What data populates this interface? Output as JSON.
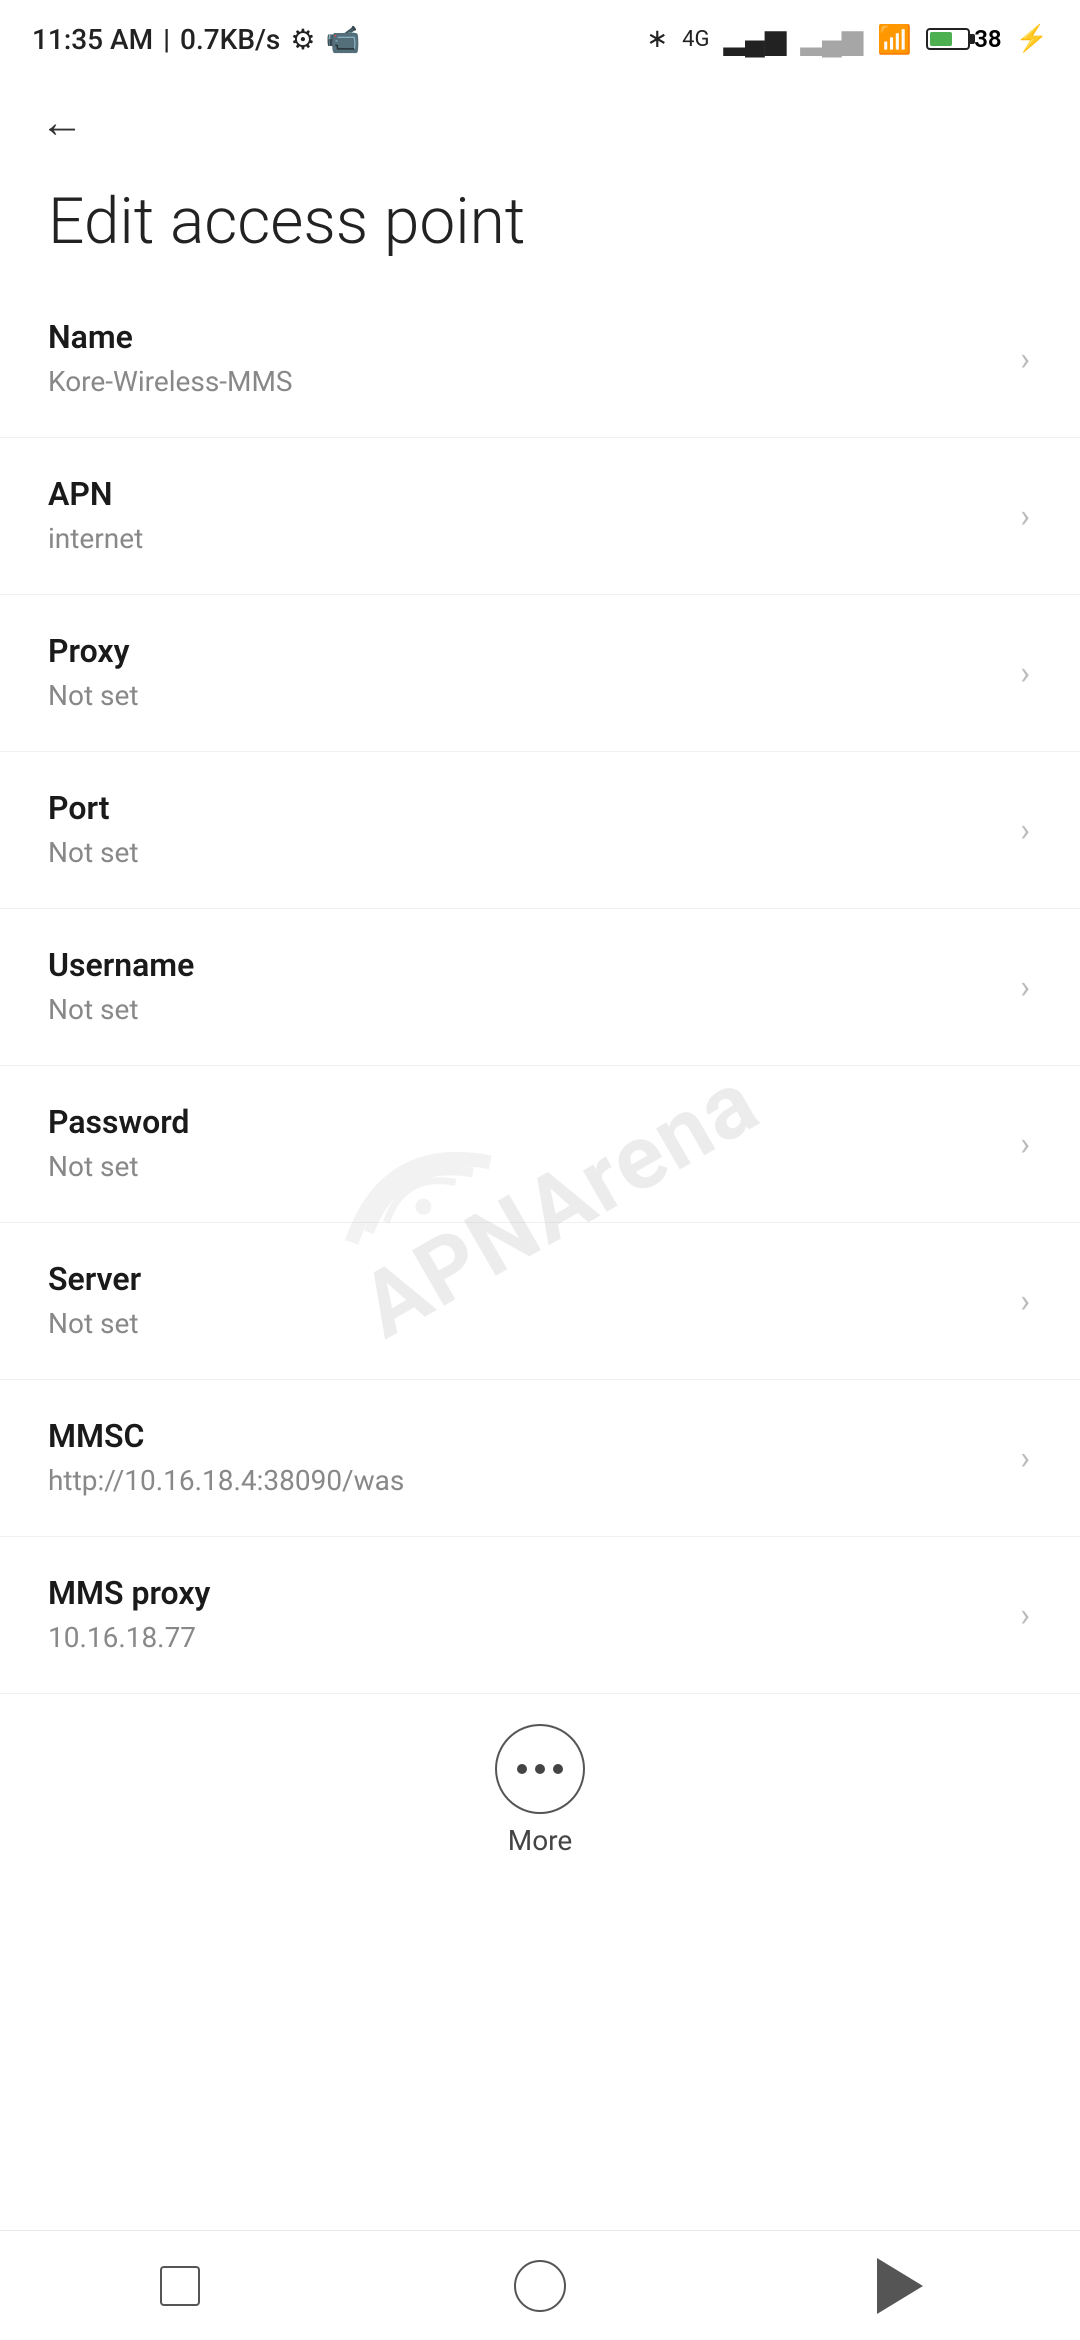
{
  "statusBar": {
    "time": "11:35 AM",
    "speed": "0.7KB/s"
  },
  "header": {
    "backLabel": "←"
  },
  "page": {
    "title": "Edit access point"
  },
  "settings": {
    "items": [
      {
        "label": "Name",
        "value": "Kore-Wireless-MMS"
      },
      {
        "label": "APN",
        "value": "internet"
      },
      {
        "label": "Proxy",
        "value": "Not set"
      },
      {
        "label": "Port",
        "value": "Not set"
      },
      {
        "label": "Username",
        "value": "Not set"
      },
      {
        "label": "Password",
        "value": "Not set"
      },
      {
        "label": "Server",
        "value": "Not set"
      },
      {
        "label": "MMSC",
        "value": "http://10.16.18.4:38090/was"
      },
      {
        "label": "MMS proxy",
        "value": "10.16.18.77"
      }
    ]
  },
  "more": {
    "label": "More"
  },
  "bottomNav": {
    "square": "recent-apps",
    "circle": "home",
    "triangle": "back"
  },
  "watermark": "APNArena"
}
